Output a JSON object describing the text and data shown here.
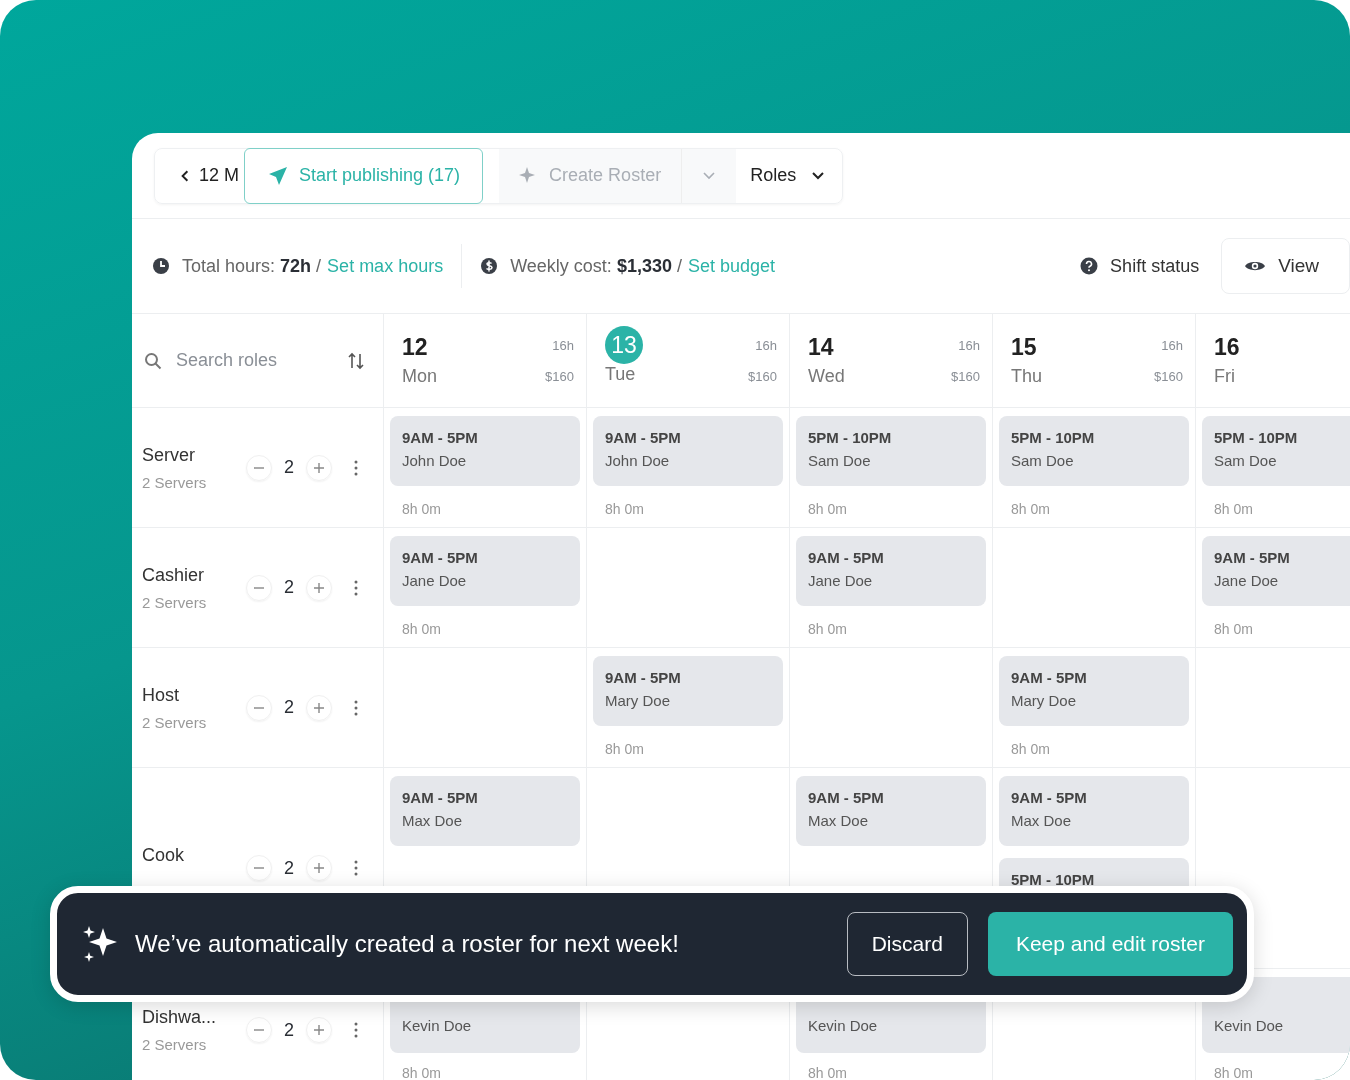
{
  "toolbar": {
    "date_label": "12 M",
    "publish_button": "Start publishing (17)",
    "create_button": {
      "label": "Create Roster",
      "disabled": true
    },
    "roles_dropdown": "Roles"
  },
  "stats": [
    {
      "kind": "hours",
      "text": "Total hours: **72h** /",
      "link": "Set max hours"
    },
    {
      "kind": "cost",
      "text": "Weekly cost: **$1,330** /",
      "link": "Set budget"
    }
  ],
  "shift_status": "Shift status",
  "view_button": "View",
  "search": {
    "placeholder": "Search roles"
  },
  "days": [
    {
      "date": "12",
      "day": "Mon",
      "hours": "16h",
      "cost": "$160",
      "selected": false
    },
    {
      "date": "13",
      "day": "Tue",
      "hours": "16h",
      "cost": "$160",
      "selected": true
    },
    {
      "date": "14",
      "day": "Wed",
      "hours": "16h",
      "cost": "$160",
      "selected": false
    },
    {
      "date": "15",
      "day": "Thu",
      "hours": "16h",
      "cost": "$160",
      "selected": false
    },
    {
      "date": "16",
      "day": "Fri",
      "selected": false
    }
  ],
  "roles": [
    {
      "name": "Server",
      "subtitle": "2 Servers",
      "count": "2",
      "cells": [
        {
          "shifts": [
            {
              "time": "9AM - 5PM",
              "name": "John Doe"
            }
          ],
          "hours": "8h 0m"
        },
        {
          "shifts": [
            {
              "time": "9AM - 5PM",
              "name": "John Doe"
            }
          ],
          "hours": "8h 0m"
        },
        {
          "shifts": [
            {
              "time": "5PM - 10PM",
              "name": "Sam Doe"
            }
          ],
          "hours": "8h 0m"
        },
        {
          "shifts": [
            {
              "time": "5PM - 10PM",
              "name": "Sam Doe"
            }
          ],
          "hours": "8h 0m"
        },
        {
          "shifts": [
            {
              "time": "5PM - 10PM",
              "name": "Sam Doe"
            }
          ],
          "hours": "8h 0m"
        }
      ]
    },
    {
      "name": "Cashier",
      "subtitle": "2 Servers",
      "count": "2",
      "cells": [
        {
          "shifts": [
            {
              "time": "9AM - 5PM",
              "name": "Jane Doe"
            }
          ],
          "hours": "8h 0m"
        },
        {},
        {
          "shifts": [
            {
              "time": "9AM - 5PM",
              "name": "Jane Doe"
            }
          ],
          "hours": "8h 0m"
        },
        {},
        {
          "shifts": [
            {
              "time": "9AM - 5PM",
              "name": "Jane Doe"
            }
          ],
          "hours": "8h 0m"
        }
      ]
    },
    {
      "name": "Host",
      "subtitle": "2 Servers",
      "count": "2",
      "cells": [
        {},
        {
          "shifts": [
            {
              "time": "9AM - 5PM",
              "name": "Mary Doe"
            }
          ],
          "hours": "8h 0m"
        },
        {},
        {
          "shifts": [
            {
              "time": "9AM - 5PM",
              "name": "Mary Doe"
            }
          ],
          "hours": "8h 0m"
        },
        {}
      ]
    },
    {
      "name": "Cook",
      "count": "2",
      "cells": [
        {
          "shifts": [
            {
              "time": "9AM - 5PM",
              "name": "Max Doe"
            }
          ]
        },
        {},
        {
          "shifts": [
            {
              "time": "9AM - 5PM",
              "name": "Max Doe"
            }
          ]
        },
        {
          "shifts": [
            {
              "time": "9AM - 5PM",
              "name": "Max Doe"
            },
            {
              "time": "5PM - 10PM"
            }
          ]
        },
        {}
      ]
    },
    {
      "name": "Dishwa...",
      "subtitle": "2 Servers",
      "count": "2",
      "cells": [
        {
          "shifts": [
            {
              "name": "Kevin Doe"
            }
          ],
          "hours": "8h 0m"
        },
        {},
        {
          "shifts": [
            {
              "name": "Kevin Doe"
            }
          ],
          "hours": "8h 0m"
        },
        {},
        {
          "shifts": [
            {
              "name": "Kevin Doe"
            }
          ],
          "hours": "8h 0m"
        }
      ]
    }
  ],
  "toast": {
    "message": "We’ve automatically created a roster for next week!",
    "discard_button": "Discard",
    "keep_button": "Keep and edit roster"
  }
}
